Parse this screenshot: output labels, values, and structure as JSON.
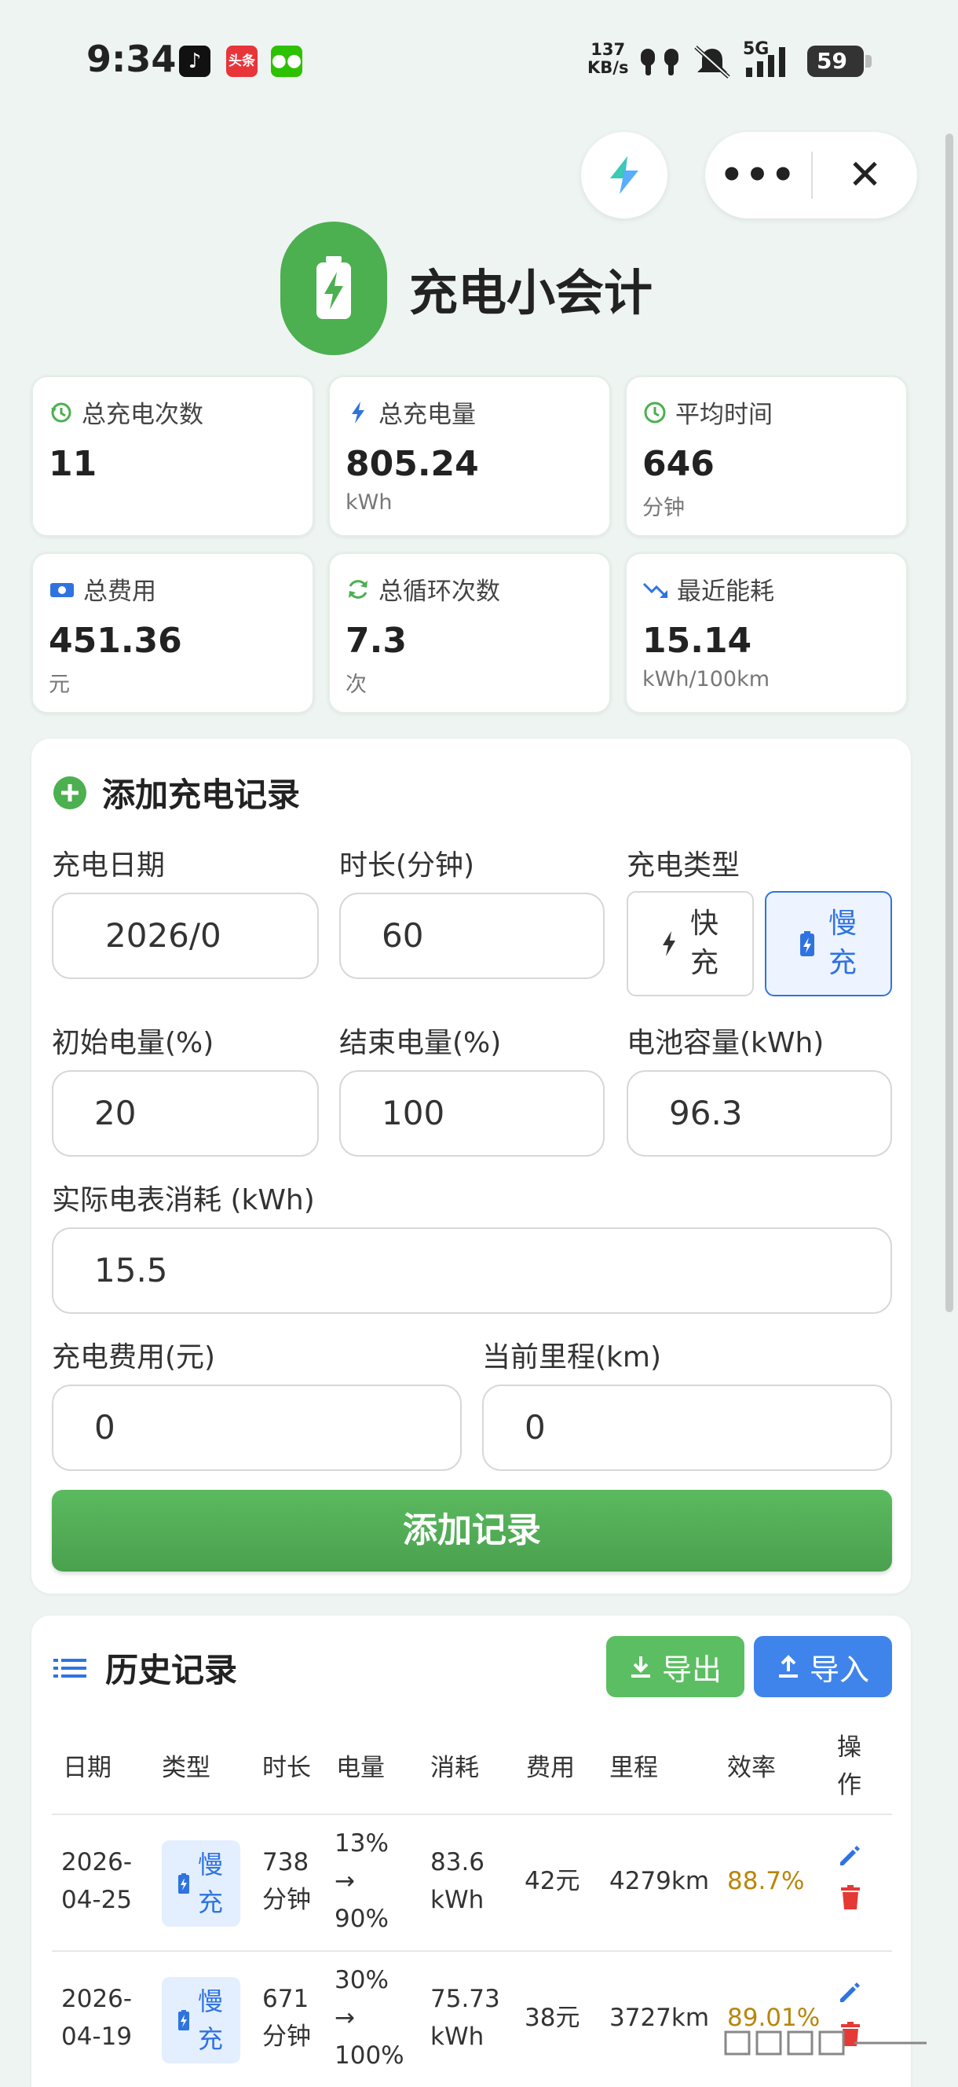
{
  "status": {
    "time": "9:34",
    "net_speed": "137",
    "net_unit": "KB/s",
    "signal": "5G",
    "battery": "59",
    "app_toutiao": "头条"
  },
  "app": {
    "title": "充电小会计"
  },
  "stats": [
    {
      "label": "总充电次数",
      "value": "11",
      "unit": "",
      "icon": "history-icon",
      "color": "#4caf50"
    },
    {
      "label": "总充电量",
      "value": "805.24",
      "unit": "kWh",
      "icon": "bolt-icon",
      "color": "#2f73e0"
    },
    {
      "label": "平均时间",
      "value": "646",
      "unit": "分钟",
      "icon": "clock-icon",
      "color": "#4caf50"
    },
    {
      "label": "总费用",
      "value": "451.36",
      "unit": "元",
      "icon": "money-icon",
      "color": "#2f73e0"
    },
    {
      "label": "总循环次数",
      "value": "7.3",
      "unit": "次",
      "icon": "cycle-icon",
      "color": "#4caf50"
    },
    {
      "label": "最近能耗",
      "value": "15.14",
      "unit": "kWh/100km",
      "icon": "trend-down-icon",
      "color": "#2f73e0"
    }
  ],
  "form": {
    "title": "添加充电记录",
    "date_label": "充电日期",
    "date_value": "2026/0",
    "duration_label": "时长(分钟)",
    "duration_value": "60",
    "type_label": "充电类型",
    "fast_label": "快充",
    "slow_label": "慢充",
    "start_label": "初始电量(%)",
    "start_value": "20",
    "end_label": "结束电量(%)",
    "end_value": "100",
    "capacity_label": "电池容量(kWh)",
    "capacity_value": "96.3",
    "meter_label": "实际电表消耗 (kWh)",
    "meter_value": "15.5",
    "cost_label": "充电费用(元)",
    "cost_value": "0",
    "mileage_label": "当前里程(km)",
    "mileage_value": "0",
    "submit_label": "添加记录"
  },
  "history": {
    "title": "历史记录",
    "export_label": "导出",
    "import_label": "导入",
    "columns": [
      "日期",
      "类型",
      "时长",
      "电量",
      "消耗",
      "费用",
      "里程",
      "效率",
      "操作"
    ],
    "rows": [
      {
        "date1": "2026-",
        "date2": "04-25",
        "type": "慢充",
        "dur1": "738",
        "dur2": "分钟",
        "pct1": "13%",
        "pct2": "→",
        "pct3": "90%",
        "use1": "83.6",
        "use2": "kWh",
        "cost": "42元",
        "mileage": "4279km",
        "eff": "88.7%"
      },
      {
        "date1": "2026-",
        "date2": "04-19",
        "type": "慢充",
        "dur1": "671",
        "dur2": "分钟",
        "pct1": "30%",
        "pct2": "→",
        "pct3": "100%",
        "use1": "75.73",
        "use2": "kWh",
        "cost": "38元",
        "mileage": "3727km",
        "eff": "89.01%"
      }
    ]
  }
}
